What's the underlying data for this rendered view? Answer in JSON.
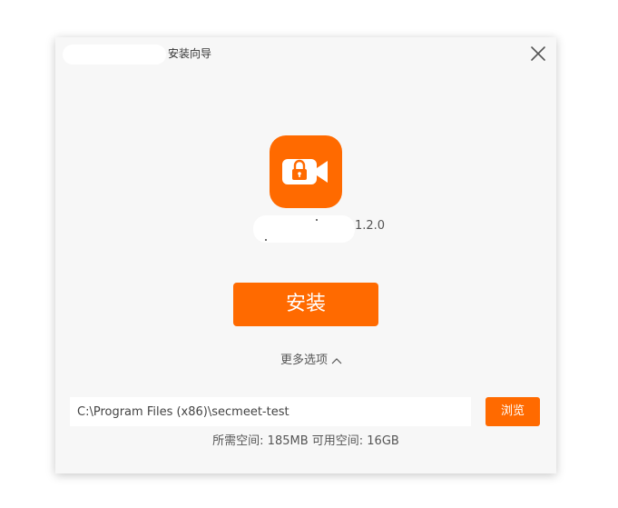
{
  "window": {
    "title": "安装向导"
  },
  "app": {
    "icon": "video-camera-lock-icon",
    "version": "1.2.0"
  },
  "actions": {
    "install_label": "安装",
    "more_options_label": "更多选项",
    "more_options_icon": "chevron-up-icon",
    "browse_label": "浏览"
  },
  "install_path": {
    "value": "C:\\Program Files (x86)\\secmeet-test"
  },
  "space": {
    "text": "所需空间: 185MB 可用空间: 16GB"
  },
  "colors": {
    "accent": "#ff6a00",
    "background": "#f7f7f7"
  }
}
